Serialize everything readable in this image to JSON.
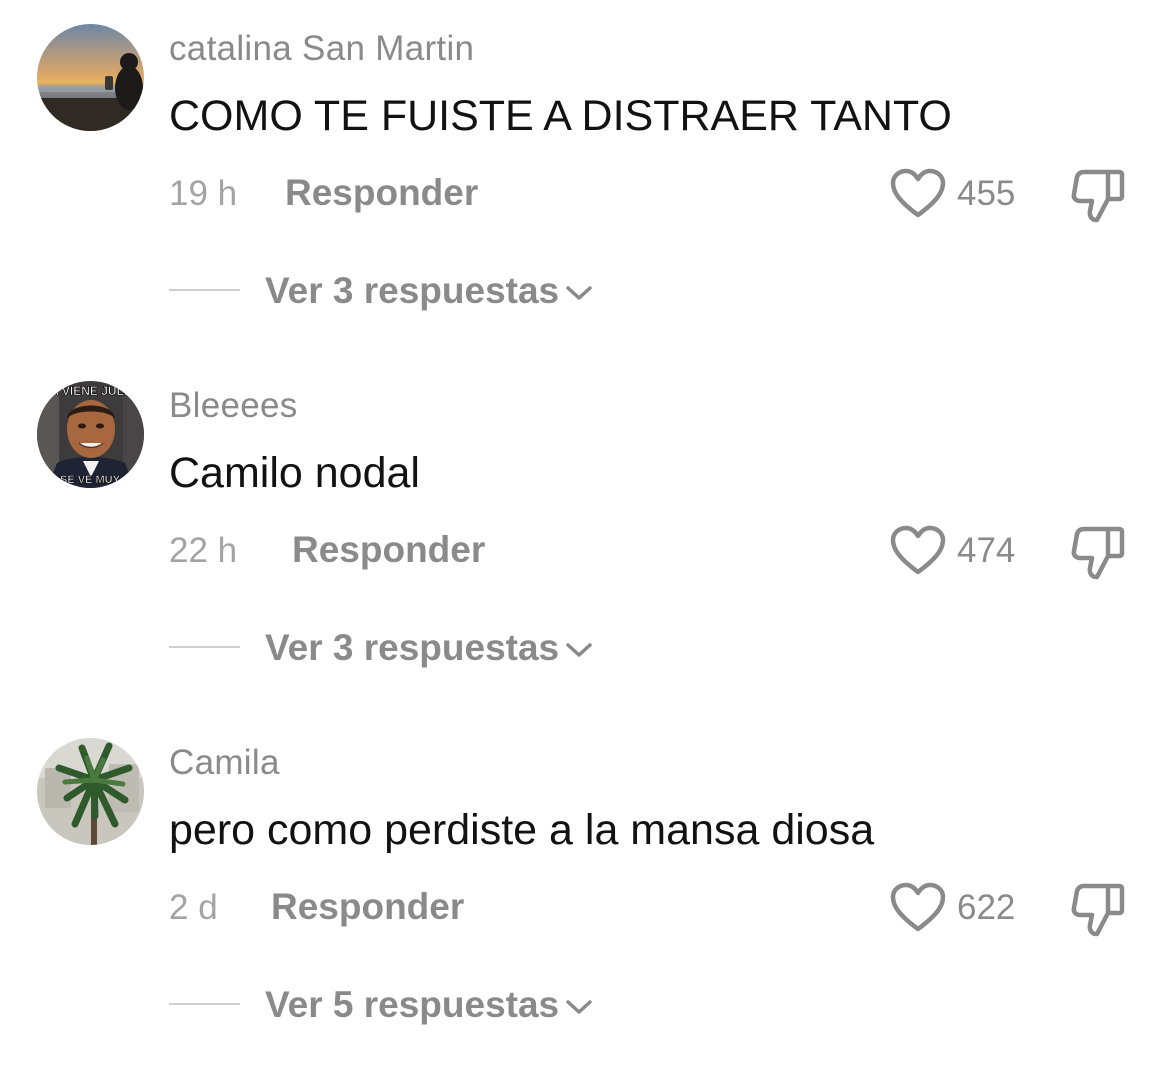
{
  "comments": [
    {
      "username": "catalina San Martin",
      "text": "COMO TE FUISTE A DISTRAER TANTO",
      "time": "19 h",
      "reply_label": "Responder",
      "likes": "455",
      "view_replies": "Ver 3 respuestas",
      "avatar": "sunset-beach-photo"
    },
    {
      "username": "Bleeees",
      "text": "Camilo nodal",
      "time": "22 h",
      "reply_label": "Responder",
      "likes": "474",
      "view_replies": "Ver 3 respuestas",
      "avatar": "meme-face-photo",
      "avatar_caption_top": "YA VIENE JULIO",
      "avatar_caption_bottom": "SE VE MUY"
    },
    {
      "username": "Camila",
      "text": "pero como perdiste a la mansa diosa",
      "time": "2 d",
      "reply_label": "Responder",
      "likes": "622",
      "view_replies": "Ver 5 respuestas",
      "avatar": "palm-tree-photo"
    }
  ],
  "icons": {
    "like": "heart-outline-icon",
    "dislike": "thumbs-down-outline-icon",
    "expand": "chevron-down-icon"
  },
  "colors": {
    "text_primary": "#121212",
    "text_secondary": "#8a8a8a",
    "icon": "#8a8a8a"
  }
}
